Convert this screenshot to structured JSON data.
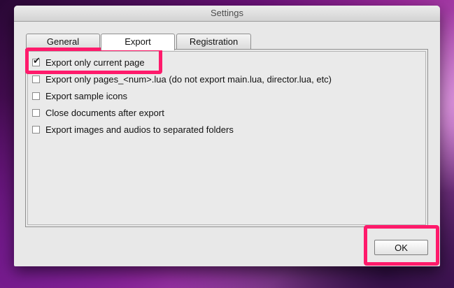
{
  "window": {
    "title": "Settings"
  },
  "tabs": [
    {
      "label": "General"
    },
    {
      "label": "Export",
      "active": true
    },
    {
      "label": "Registration"
    }
  ],
  "options": [
    {
      "label": "Export only current page",
      "checked": true
    },
    {
      "label": "Export only pages_<num>.lua (do not export main.lua, director.lua, etc)",
      "checked": false
    },
    {
      "label": "Export sample icons",
      "checked": false
    },
    {
      "label": "Close documents after export",
      "checked": false
    },
    {
      "label": "Export images and audios to separated folders",
      "checked": false
    }
  ],
  "buttons": {
    "ok_label": "OK"
  },
  "colors": {
    "highlight": "#ff1a6b",
    "window_bg": "#e8e8e8"
  },
  "icons": {
    "checkmark": "checkmark-icon"
  }
}
